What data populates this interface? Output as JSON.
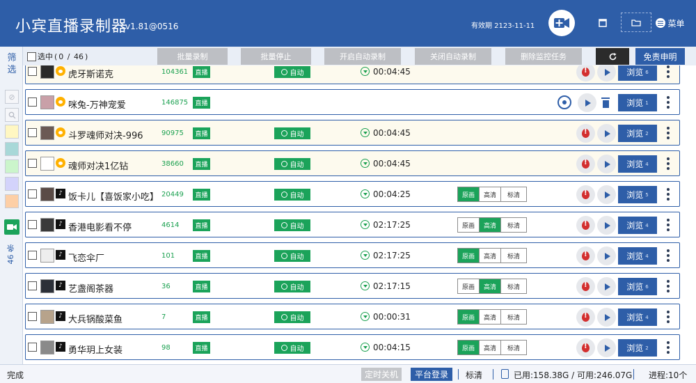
{
  "header": {
    "title": "小宾直播录制器",
    "version": "v1.81@0516",
    "expiry": "有效期 2123-11-11",
    "menu_label": "菜单"
  },
  "sidebar": {
    "filter_label": "筛选",
    "count_label": "46 条",
    "color_swatches": [
      "#fff7c2",
      "#a8d8d8",
      "#cbf5cb",
      "#d3d3fb",
      "#fdcfa6"
    ]
  },
  "toolbar": {
    "select_label": "选中",
    "selected": "0",
    "total": "46",
    "buttons": [
      "批量录制",
      "批量停止",
      "开启自动录制",
      "关闭自动录制",
      "删除监控任务"
    ],
    "disclaimer_label": "免责申明"
  },
  "rows": [
    {
      "name": "虎牙斯诺克",
      "id": "104361",
      "platform": "huya",
      "live": "直播",
      "auto": "自动",
      "duration": "00:04:45",
      "browse": "浏览",
      "browse_count": "6",
      "qualities": [],
      "state": "recording",
      "alt": true
    },
    {
      "name": "咪兔-万神宠爱",
      "id": "146875",
      "platform": "huya",
      "live": "直播",
      "auto": "",
      "duration": "",
      "browse": "浏览",
      "browse_count": "1",
      "qualities": [],
      "state": "idle",
      "alt": false
    },
    {
      "name": "斗罗魂师对决-996",
      "id": "90975",
      "platform": "huya",
      "live": "直播",
      "auto": "自动",
      "duration": "00:04:45",
      "browse": "浏览",
      "browse_count": "2",
      "qualities": [],
      "state": "recording",
      "alt": true
    },
    {
      "name": "魂师对决1亿钻",
      "id": "38660",
      "platform": "huya",
      "live": "直播",
      "auto": "自动",
      "duration": "00:04:45",
      "browse": "浏览",
      "browse_count": "4",
      "qualities": [],
      "state": "recording",
      "alt": true
    },
    {
      "name": "饭卡儿【喜饭家小吃】",
      "id": "20449",
      "platform": "douyin",
      "live": "直播",
      "auto": "自动",
      "duration": "00:04:25",
      "browse": "浏览",
      "browse_count": "5",
      "qualities": [
        "原画",
        "高清",
        "标清"
      ],
      "quality_selected": 0,
      "state": "recording",
      "alt": false
    },
    {
      "name": "香港电影看不停",
      "id": "4614",
      "platform": "douyin",
      "live": "直播",
      "auto": "自动",
      "duration": "02:17:25",
      "browse": "浏览",
      "browse_count": "4",
      "qualities": [
        "原画",
        "高清",
        "标清"
      ],
      "quality_selected": 1,
      "state": "recording",
      "alt": false
    },
    {
      "name": "飞恋伞厂",
      "id": "101",
      "platform": "douyin",
      "live": "直播",
      "auto": "自动",
      "duration": "02:17:25",
      "browse": "浏览",
      "browse_count": "4",
      "qualities": [
        "原画",
        "高清",
        "标清"
      ],
      "quality_selected": 0,
      "state": "recording",
      "alt": false
    },
    {
      "name": "艺盏阁茶器",
      "id": "36",
      "platform": "douyin",
      "live": "直播",
      "auto": "自动",
      "duration": "02:17:15",
      "browse": "浏览",
      "browse_count": "6",
      "qualities": [
        "原画",
        "高清",
        "标清"
      ],
      "quality_selected": 1,
      "state": "recording",
      "alt": false
    },
    {
      "name": "大兵锅酸菜鱼",
      "id": "7",
      "platform": "douyin",
      "live": "直播",
      "auto": "自动",
      "duration": "00:00:31",
      "browse": "浏览",
      "browse_count": "4",
      "qualities": [
        "原画",
        "高清",
        "标清"
      ],
      "quality_selected": 0,
      "state": "recording",
      "alt": false
    },
    {
      "name": "勇华玥上女装",
      "id": "98",
      "platform": "douyin",
      "live": "直播",
      "auto": "自动",
      "duration": "00:04:15",
      "browse": "浏览",
      "browse_count": "2",
      "qualities": [
        "原画",
        "高清",
        "标清"
      ],
      "quality_selected": 0,
      "state": "recording",
      "alt": false
    }
  ],
  "status": {
    "done": "完成",
    "shutdown": "定时关机",
    "login": "平台登录",
    "quality": "标清",
    "disk": "已用:158.38G / 可用:246.07G",
    "process": "进程:10个"
  },
  "colors": {
    "primary": "#2e5ea8",
    "green": "#1ba35a",
    "record_red": "#d32f2f"
  }
}
